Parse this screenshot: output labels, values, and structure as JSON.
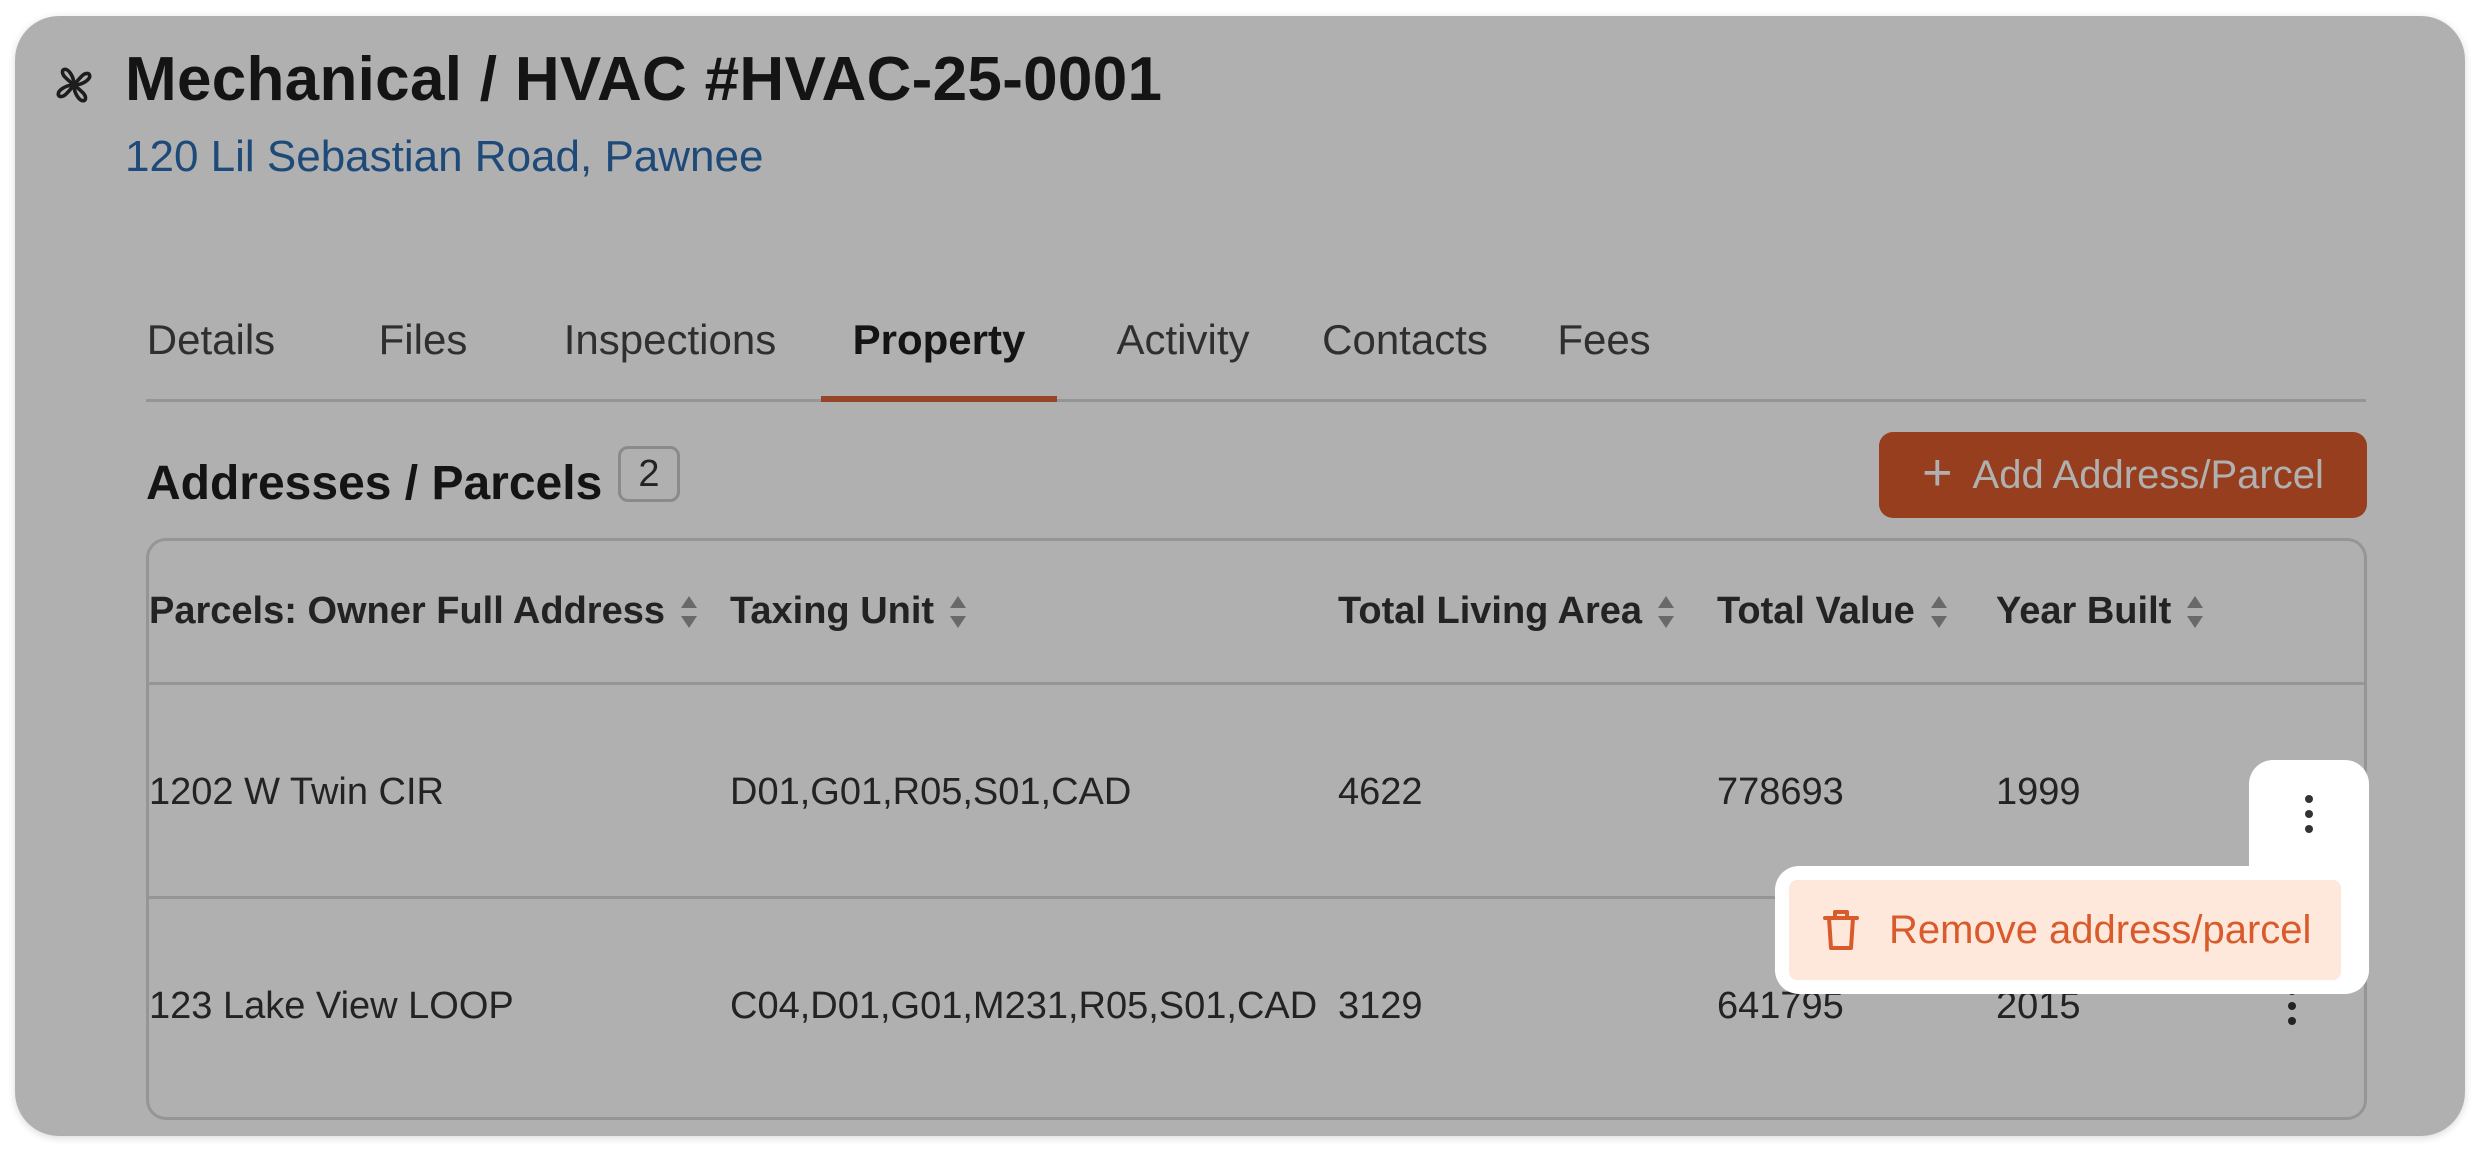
{
  "header": {
    "icon": "fan-icon",
    "title": "Mechanical / HVAC #HVAC-25-0001",
    "address": "120 Lil Sebastian Road, Pawnee"
  },
  "tabs": [
    {
      "label": "Details",
      "active": false
    },
    {
      "label": "Files",
      "active": false
    },
    {
      "label": "Inspections",
      "active": false
    },
    {
      "label": "Property",
      "active": true
    },
    {
      "label": "Activity",
      "active": false
    },
    {
      "label": "Contacts",
      "active": false
    },
    {
      "label": "Fees",
      "active": false
    }
  ],
  "section": {
    "title": "Addresses / Parcels",
    "count": "2",
    "add_button_label": "Add Address/Parcel",
    "add_button_icon": "plus-icon"
  },
  "table": {
    "columns": [
      "Parcels: Owner Full Address",
      "Taxing Unit",
      "Total Living Area",
      "Total Value",
      "Year Built"
    ],
    "rows": [
      [
        "1202 W Twin CIR",
        "D01,G01,R05,S01,CAD",
        "4622",
        "778693",
        "1999"
      ],
      [
        "123 Lake View LOOP",
        "C04,D01,G01,M231,R05,S01,CAD",
        "3129",
        "641795",
        "2015"
      ]
    ]
  },
  "context_menu": {
    "items": [
      {
        "label": "Remove address/parcel",
        "icon": "trash-icon"
      }
    ]
  },
  "colors": {
    "accent": "#d95a2b",
    "link": "#2b6cb0",
    "menu_item_bg": "#fde8db",
    "overlay": "rgba(0,0,0,0.31)"
  }
}
